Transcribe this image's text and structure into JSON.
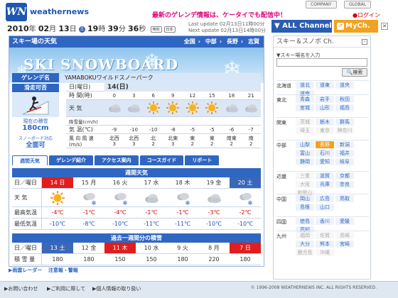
{
  "header": {
    "brand": "weathernews",
    "promo": "最新のゲレンデ情報は、ケータイでも配信中！",
    "company": "COMPANY",
    "global": "GLOBAL",
    "login": "ログイン",
    "year": "2010",
    "year_unit": "年",
    "month": "02",
    "month_unit": "月",
    "day": "13",
    "day_unit": "日",
    "hour": "19",
    "hour_unit": "時",
    "minute": "39",
    "minute_unit": "分",
    "second": "36",
    "second_unit": "秒",
    "last_update": "Last update  02月13日11時00分",
    "next_update": "Next update  02月13日14時00分",
    "all_channel": "ALL Channel",
    "mych": "MyCh."
  },
  "main": {
    "title": "スキー場の天気",
    "regions": [
      "全国",
      "中部",
      "長野",
      "志賀"
    ],
    "banner": "SKI SNOWBOARD",
    "gelande_label": "ゲレンデ名",
    "gelande_name": "YAMABOKUワイルドスノーパーク",
    "status": "滑走可否",
    "current_snow_label": "現在の積雪",
    "current_snow": "180cm",
    "snowboard_label": "スノーボード対応",
    "snowboard_value": "全面可",
    "forecast": {
      "date_label": "日(曜日)",
      "date_value": "14(日)",
      "time_label": "時 間(時)",
      "times": [
        "0",
        "3",
        "6",
        "9",
        "12",
        "15",
        "18",
        "21"
      ],
      "weather_label": "天 気",
      "weather": [
        "cloud",
        "cloud",
        "sun",
        "sun",
        "sun",
        "sun",
        "cloud",
        "cloud"
      ],
      "precip_label": "降雪量(cm/h)",
      "precip": [
        "",
        "",
        "",
        "",
        "",
        "",
        "",
        ""
      ],
      "temp_label": "気 温(℃)",
      "temps": [
        "-9",
        "-10",
        "-10",
        "-8",
        "-5",
        "-5",
        "-6",
        "-7"
      ],
      "wind_label": "風 向 風 速(m/s)",
      "wind_dir": [
        "北西",
        "北西",
        "北",
        "北東",
        "東",
        "東",
        "南東",
        "南"
      ],
      "wind_speed": [
        "3",
        "3",
        "2",
        "3",
        "2",
        "2",
        "2",
        "2"
      ]
    },
    "tabs": [
      "週間天気",
      "ゲレンデ紹介",
      "アクセス案内",
      "コースガイド",
      "リポート"
    ],
    "weekly": {
      "title": "週間天気",
      "day_label": "日／曜日",
      "weather_label": "天 気",
      "max_label": "最高気温",
      "min_label": "最低気温",
      "days": [
        {
          "date": "14 日",
          "type": "sunday",
          "weather": "sun",
          "max": "-4℃",
          "min": "-10℃"
        },
        {
          "date": "15 月",
          "type": "",
          "weather": "snow",
          "max": "-1℃",
          "min": "-8℃"
        },
        {
          "date": "16 火",
          "type": "",
          "weather": "snow",
          "max": "-4℃",
          "min": "-10℃"
        },
        {
          "date": "17 水",
          "type": "",
          "weather": "cloud",
          "max": "-1℃",
          "min": "-11℃"
        },
        {
          "date": "18 木",
          "type": "",
          "weather": "snow",
          "max": "-1℃",
          "min": "-11℃"
        },
        {
          "date": "19 金",
          "type": "",
          "weather": "cloud",
          "max": "-3℃",
          "min": "-10℃"
        },
        {
          "date": "20 土",
          "type": "sat",
          "weather": "snow",
          "max": "-2℃",
          "min": "-10℃"
        }
      ]
    },
    "history": {
      "title": "過去一週間分の積雪",
      "day_label": "日／曜日",
      "snow_label": "積 雪 量",
      "days": [
        {
          "date": "13 土",
          "type": "sat",
          "value": "180"
        },
        {
          "date": "12 金",
          "type": "",
          "value": "180"
        },
        {
          "date": "11 木",
          "type": "sunday",
          "value": "150"
        },
        {
          "date": "10 水",
          "type": "",
          "value": "150"
        },
        {
          "date": "9 火",
          "type": "",
          "value": "180"
        },
        {
          "date": "8 月",
          "type": "",
          "value": "220"
        },
        {
          "date": "7 日",
          "type": "sunday",
          "value": "180"
        }
      ]
    },
    "footbar": [
      "雨雲レーダー",
      "注意報・警報"
    ]
  },
  "side": {
    "title": "スキー＆スノボ Ch.",
    "search_label": "▼スキー場名を入力",
    "search_button": "検索",
    "regions": [
      {
        "name": "北海道",
        "prefs": [
          {
            "n": "道北"
          },
          {
            "n": "道東"
          },
          {
            "n": "道央"
          },
          {
            "n": "道南"
          }
        ]
      },
      {
        "name": "東北",
        "prefs": [
          {
            "n": "青森"
          },
          {
            "n": "岩手"
          },
          {
            "n": "秋田"
          },
          {
            "n": "宮城"
          },
          {
            "n": "山形"
          },
          {
            "n": "福島"
          }
        ]
      },
      {
        "name": "関東",
        "prefs": [
          {
            "n": "茨城",
            "dim": true
          },
          {
            "n": "栃木"
          },
          {
            "n": "群馬"
          },
          {
            "n": "埼玉",
            "dim": true
          },
          {
            "n": "東京",
            "dim": true
          },
          {
            "n": "神奈川",
            "dim": true
          }
        ]
      },
      {
        "name": "中部",
        "prefs": [
          {
            "n": "山梨"
          },
          {
            "n": "長野",
            "cur": true
          },
          {
            "n": "新潟"
          },
          {
            "n": "富山"
          },
          {
            "n": "石川"
          },
          {
            "n": "福井"
          },
          {
            "n": "静岡"
          },
          {
            "n": "愛知"
          },
          {
            "n": "岐阜"
          }
        ]
      },
      {
        "name": "近畿",
        "prefs": [
          {
            "n": "三重",
            "dim": true
          },
          {
            "n": "滋賀"
          },
          {
            "n": "京都"
          },
          {
            "n": "大阪",
            "dim": true
          },
          {
            "n": "兵庫"
          },
          {
            "n": "奈良"
          },
          {
            "n": "和歌山",
            "dim": true
          }
        ]
      },
      {
        "name": "中国",
        "prefs": [
          {
            "n": "岡山"
          },
          {
            "n": "広島"
          },
          {
            "n": "鳥取"
          },
          {
            "n": "島根"
          },
          {
            "n": "山口"
          }
        ]
      },
      {
        "name": "四国",
        "prefs": [
          {
            "n": "徳島"
          },
          {
            "n": "香川"
          },
          {
            "n": "愛媛"
          },
          {
            "n": "高知"
          }
        ]
      },
      {
        "name": "九州",
        "prefs": [
          {
            "n": "福岡",
            "dim": true
          },
          {
            "n": "佐賀",
            "dim": true
          },
          {
            "n": "長崎",
            "dim": true
          },
          {
            "n": "大分"
          },
          {
            "n": "熊本"
          },
          {
            "n": "宮崎"
          },
          {
            "n": "鹿児島",
            "dim": true
          },
          {
            "n": "沖縄",
            "dim": true
          }
        ]
      }
    ]
  },
  "footer": {
    "links": [
      "お問い合わせ",
      "ご利用に際して",
      "個人情報の取り扱い"
    ],
    "copyright": "© 1996-2008 WEATHERNEWS INC. ALL RIGHTS RESERVED."
  },
  "colors": {
    "accent": "#2f66c2",
    "promo": "#e0007a",
    "mych": "#f1a21e",
    "sunday": "#e21d1d"
  }
}
